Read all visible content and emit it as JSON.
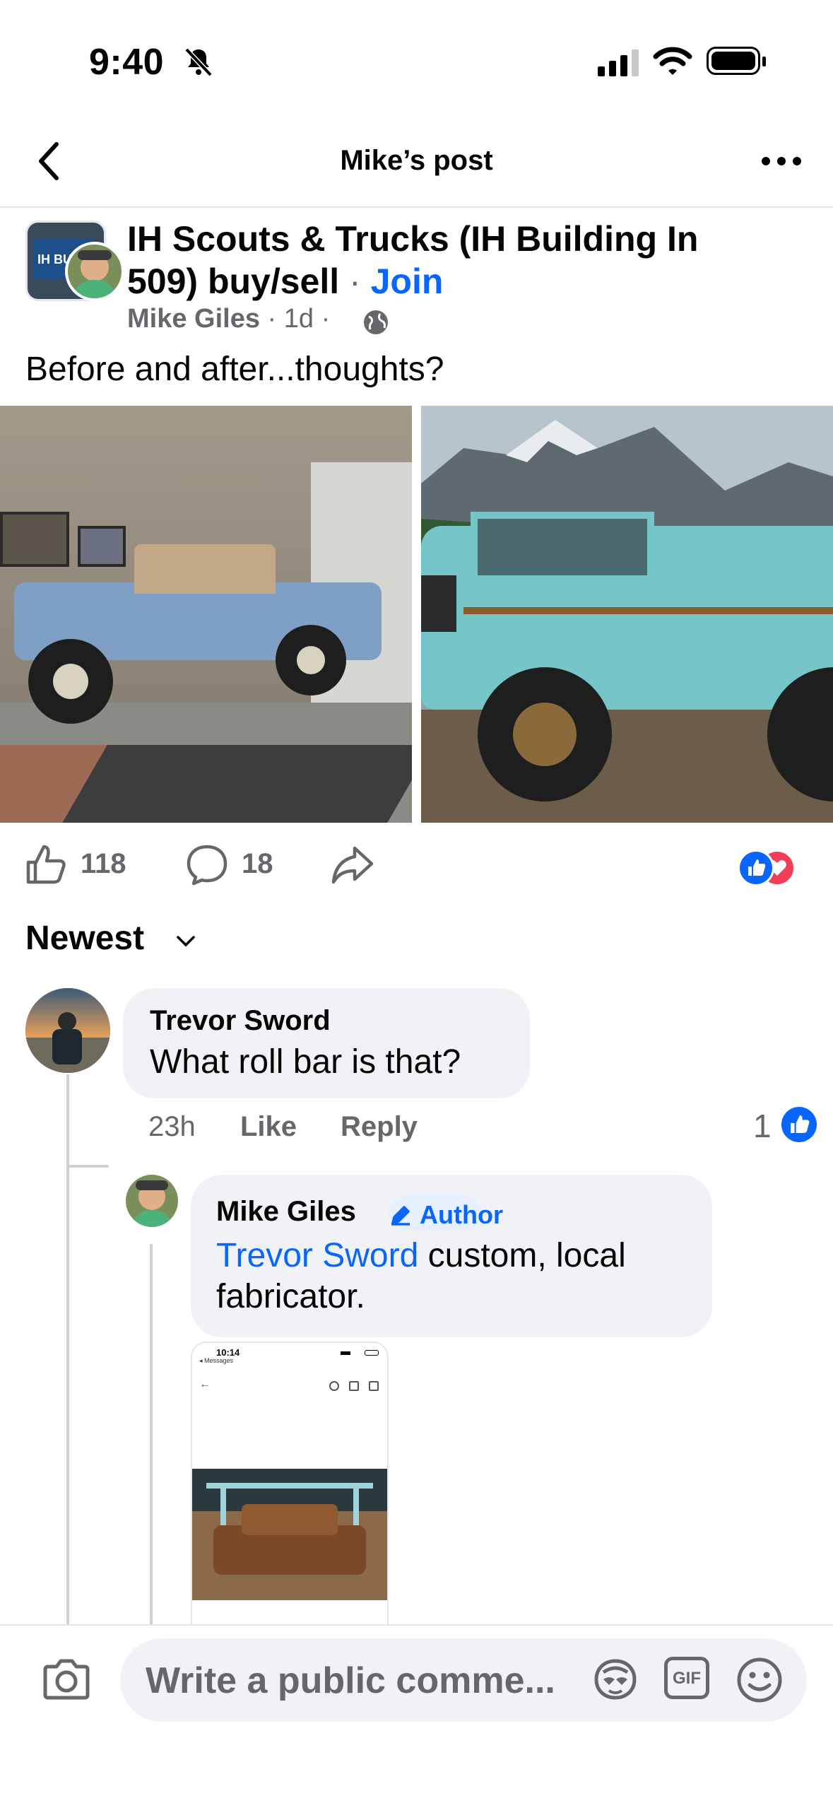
{
  "status_bar": {
    "time": "9:40"
  },
  "nav": {
    "title": "Mike’s post"
  },
  "post": {
    "group_name": "IH Scouts & Trucks (IH Building In 509) buy/sell",
    "join_separator": " · ",
    "join_label": "Join",
    "author": "Mike Giles",
    "time": "· 1d ·",
    "text": "Before and after...thoughts?",
    "like_count": "118",
    "comment_count": "18"
  },
  "sort": {
    "label": "Newest"
  },
  "comments": [
    {
      "name": "Trevor Sword",
      "text": "What roll bar is that?",
      "time": "23h",
      "like_label": "Like",
      "reply_label": "Reply",
      "reaction_count": "1"
    }
  ],
  "reply": {
    "name": "Mike Giles",
    "badge": "Author",
    "mention": "Trevor Sword",
    "text_line1": " custom, local",
    "text_line2": "fabricator.",
    "screenshot_time": "10:14",
    "screenshot_back": "◂ Messages"
  },
  "composer": {
    "placeholder": "Write a public comme..."
  },
  "colors": {
    "accent": "#0866ff",
    "love": "#f33e58",
    "bubble": "#f0f2f5",
    "secondary_text": "#65676b"
  }
}
